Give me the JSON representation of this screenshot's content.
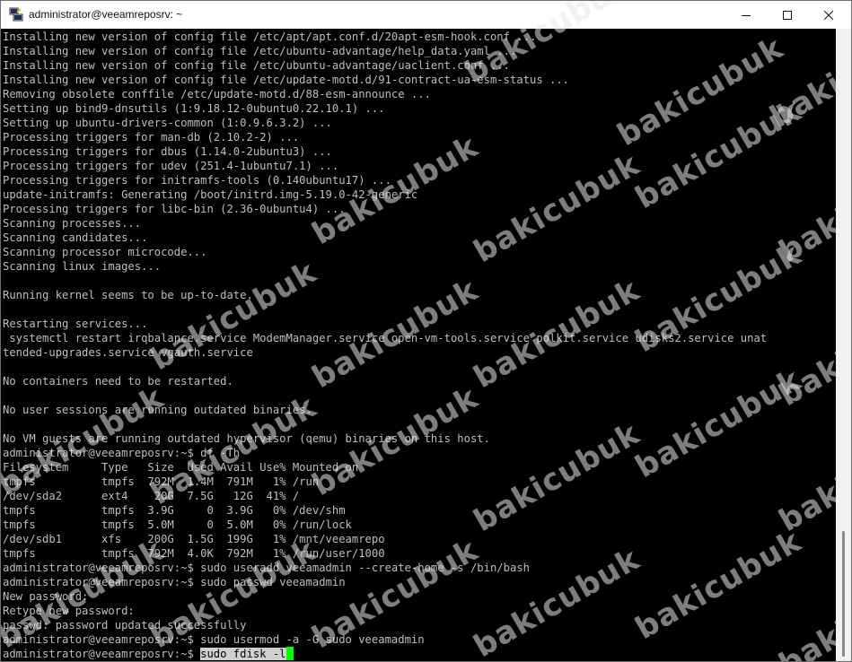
{
  "window": {
    "title": "administrator@veeamreposrv: ~",
    "app_icon": "putty-icon",
    "controls": {
      "minimize_icon": "minimize-icon",
      "maximize_icon": "maximize-icon",
      "close_icon": "close-icon"
    }
  },
  "terminal": {
    "lines": [
      "Installing new version of config file /etc/apt/apt.conf.d/20apt-esm-hook.conf ...",
      "Installing new version of config file /etc/ubuntu-advantage/help_data.yaml ...",
      "Installing new version of config file /etc/ubuntu-advantage/uaclient.conf ...",
      "Installing new version of config file /etc/update-motd.d/91-contract-ua-esm-status ...",
      "Removing obsolete conffile /etc/update-motd.d/88-esm-announce ...",
      "Setting up bind9-dnsutils (1:9.18.12-0ubuntu0.22.10.1) ...",
      "Setting up ubuntu-drivers-common (1:0.9.6.3.2) ...",
      "Processing triggers for man-db (2.10.2-2) ...",
      "Processing triggers for dbus (1.14.0-2ubuntu3) ...",
      "Processing triggers for udev (251.4-1ubuntu7.1) ...",
      "Processing triggers for initramfs-tools (0.140ubuntu17) ...",
      "update-initramfs: Generating /boot/initrd.img-5.19.0-42-generic",
      "Processing triggers for libc-bin (2.36-0ubuntu4) ...",
      "Scanning processes...",
      "Scanning candidates...",
      "Scanning processor microcode...",
      "Scanning linux images...",
      "",
      "Running kernel seems to be up-to-date.",
      "",
      "Restarting services...",
      " systemctl restart irqbalance.service ModemManager.service open-vm-tools.service polkit.service udisks2.service unat",
      "tended-upgrades.service vgauth.service",
      "",
      "No containers need to be restarted.",
      "",
      "No user sessions are running outdated binaries.",
      "",
      "No VM guests are running outdated hypervisor (qemu) binaries on this host.",
      "administrator@veeamreposrv:~$ df -Th",
      "Filesystem     Type   Size  Used Avail Use% Mounted on",
      "tmpfs          tmpfs  792M  1.4M  791M   1% /run",
      "/dev/sda2      ext4    20G  7.5G   12G  41% /",
      "tmpfs          tmpfs  3.9G     0  3.9G   0% /dev/shm",
      "tmpfs          tmpfs  5.0M     0  5.0M   0% /run/lock",
      "/dev/sdb1      xfs    200G  1.5G  199G   1% /mnt/veeamrepo",
      "tmpfs          tmpfs  792M  4.0K  792M   1% /run/user/1000",
      "administrator@veeamreposrv:~$ sudo useradd veeamadmin --create-home -s /bin/bash",
      "administrator@veeamreposrv:~$ sudo passwd veeamadmin",
      "New password:",
      "Retype new password:",
      "passwd: password updated successfully",
      "administrator@veeamreposrv:~$ sudo usermod -a -G sudo veeamadmin"
    ],
    "current_prompt": "administrator@veeamreposrv:~$ ",
    "current_command": "sudo fdisk -l",
    "text_color": "#bfbfbf",
    "background_color": "#000000",
    "cursor_color": "#00ff00"
  },
  "watermark": {
    "text": "bakicubuk"
  }
}
